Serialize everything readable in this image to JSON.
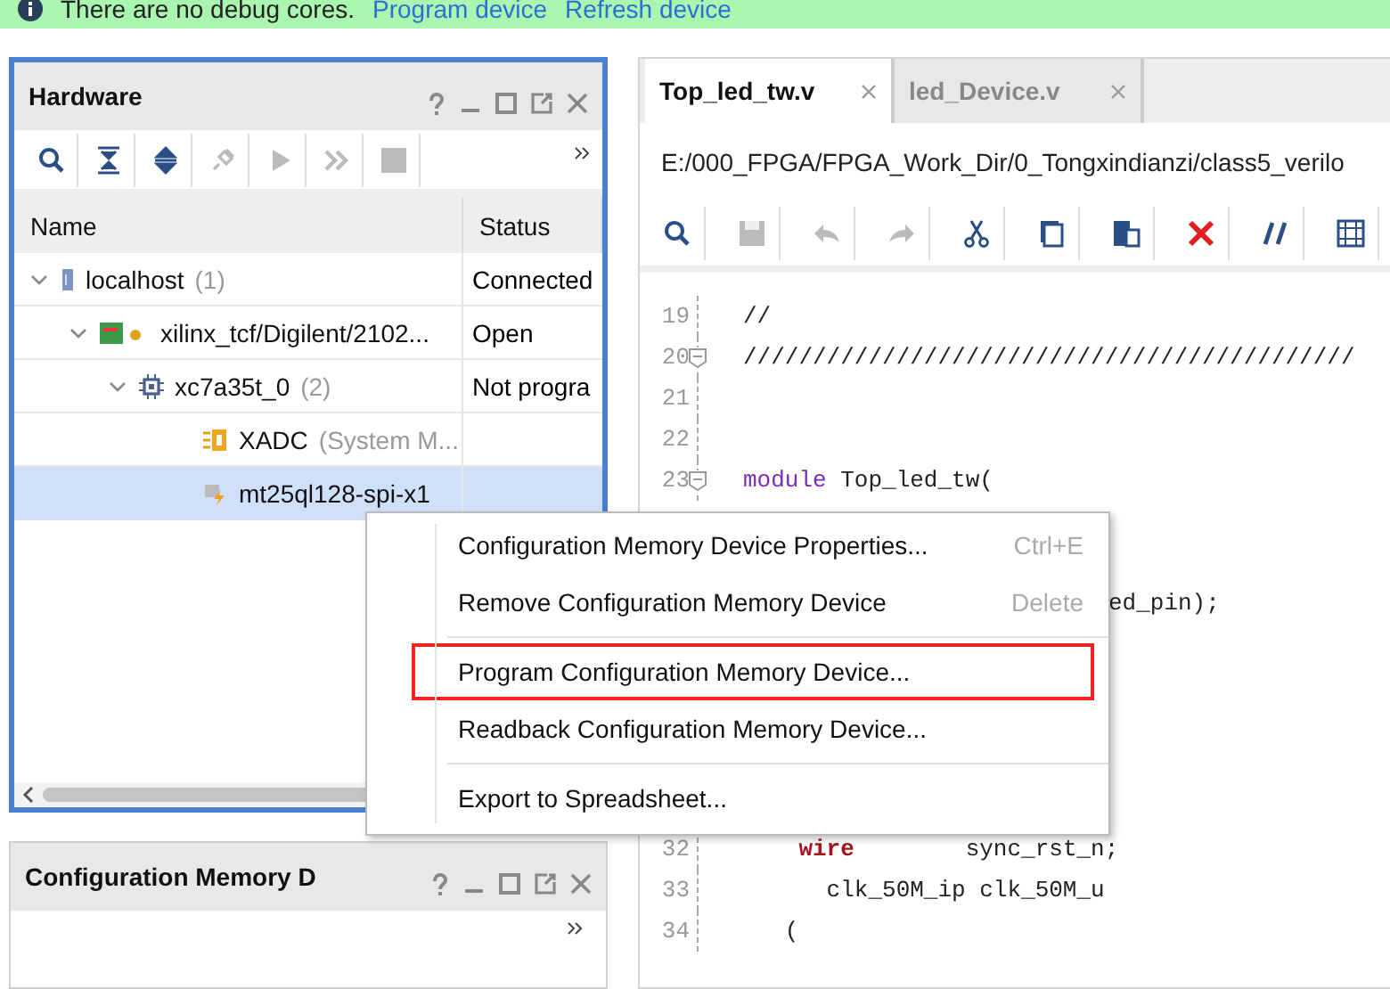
{
  "banner": {
    "message": "There are no debug cores.",
    "links": [
      "Program device",
      "Refresh device"
    ]
  },
  "hardware": {
    "title": "Hardware",
    "columns": [
      "Name",
      "Status"
    ],
    "tree": [
      {
        "name": "localhost",
        "count": "(1)",
        "status": "Connected",
        "expanded": true,
        "selected": false,
        "kind": "server",
        "children": [
          {
            "name": "xilinx_tcf/Digilent/2102...",
            "status": "Open",
            "expanded": true,
            "selected": false,
            "kind": "cable",
            "children": [
              {
                "name": "xc7a35t_0",
                "count": "(2)",
                "status": "Not progra",
                "expanded": true,
                "selected": false,
                "kind": "chip",
                "children": [
                  {
                    "name": "XADC",
                    "count": "(System M...",
                    "selected": false,
                    "kind": "xadc"
                  },
                  {
                    "name": "mt25ql128-spi-x1",
                    "selected": true,
                    "kind": "memory"
                  }
                ]
              }
            ]
          }
        ]
      }
    ]
  },
  "memory_panel": {
    "title": "Configuration Memory D"
  },
  "editor": {
    "tabs": [
      {
        "label": "Top_led_tw.v",
        "selected": true
      },
      {
        "label": "led_Device.v",
        "selected": false
      }
    ],
    "path": "E:/000_FPGA/FPGA_Work_Dir/0_Tongxindianzi/class5_verilo",
    "lines": [
      {
        "kind": "code",
        "number": "19",
        "text": "//"
      },
      {
        "kind": "code",
        "number": "20",
        "text": "////////////////////////////////////////////",
        "fold": true
      },
      {
        "kind": "code",
        "number": "21"
      },
      {
        "kind": "code",
        "number": "22"
      },
      {
        "kind": "code",
        "number": "23",
        "keyword": "module",
        "text": " Top_led_tw(",
        "fold": true
      },
      {
        "kind": "covered"
      },
      {
        "kind": "covered"
      },
      {
        "kind": "fragment",
        "text": "ed_pin);"
      },
      {
        "kind": "covered"
      },
      {
        "kind": "covered"
      },
      {
        "kind": "covered"
      },
      {
        "kind": "covered"
      },
      {
        "kind": "covered"
      },
      {
        "kind": "code",
        "number": "32",
        "keyword": "wire",
        "indented": true,
        "text": "        sync_rst_n;"
      },
      {
        "kind": "code",
        "number": "33",
        "text": "      clk_50M_ip clk_50M_u"
      },
      {
        "kind": "code",
        "number": "34",
        "text": "   ("
      }
    ]
  },
  "context_menu": [
    {
      "kind": "item",
      "label": "Configuration Memory Device Properties...",
      "shortcut": "Ctrl+E",
      "highlighted": false
    },
    {
      "kind": "item",
      "label": "Remove Configuration Memory Device",
      "shortcut": "Delete",
      "highlighted": false
    },
    {
      "kind": "separator"
    },
    {
      "kind": "item",
      "label": "Program Configuration Memory Device...",
      "highlighted": true
    },
    {
      "kind": "item",
      "label": "Readback Configuration Memory Device...",
      "highlighted": false
    },
    {
      "kind": "separator"
    },
    {
      "kind": "item",
      "label": "Export to Spreadsheet...",
      "highlighted": false
    }
  ]
}
